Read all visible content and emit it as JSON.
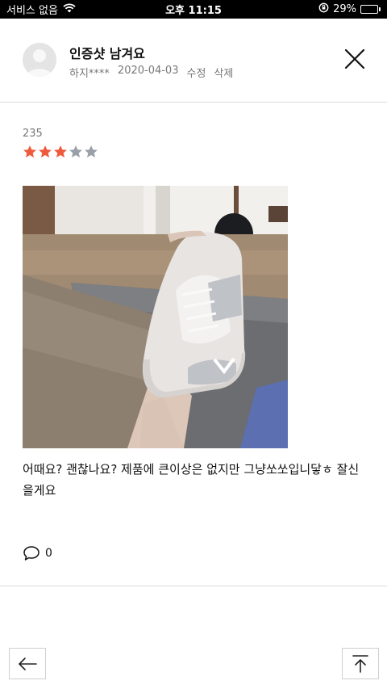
{
  "statusbar": {
    "carrier": "서비스 없음",
    "time": "오후 11:15",
    "battery_percent": "29%",
    "battery_level": 0.29
  },
  "header": {
    "title": "인증샷 남겨요",
    "author": "하지****",
    "date": "2020-04-03",
    "edit_label": "수정",
    "delete_label": "삭제"
  },
  "review": {
    "rating_value": "235",
    "stars_filled": 3,
    "stars_total": 5,
    "text": "어때요? 괜찮나요? 제품에 큰이상은 없지만 그냥쏘쏘입니닿ㅎ 잘신을게요",
    "comment_count": "0"
  },
  "colors": {
    "star_filled": "#ef5a3c",
    "star_empty": "#9aa0a8"
  },
  "icons": {
    "close": "close-icon",
    "comment": "comment-bubble-icon",
    "back": "arrow-left-icon",
    "scroll_top": "arrow-up-to-top-icon"
  }
}
